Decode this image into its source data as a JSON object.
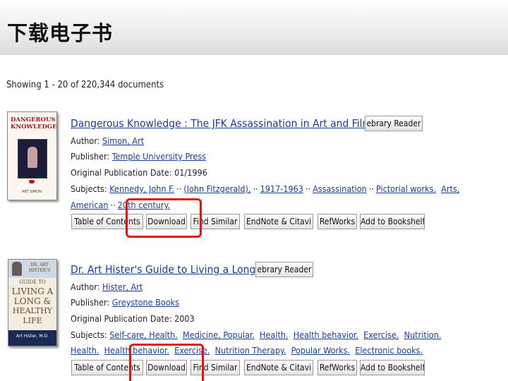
{
  "slide": {
    "title": "下载电子书"
  },
  "results": {
    "showing": "Showing 1 - 20 of 220,344 documents",
    "items": [
      {
        "title": "Dangerous Knowledge : The JFK Assassination in Art and Film",
        "reader_btn": "ebrary Reader",
        "author_label": "Author:",
        "author": "Simon, Art",
        "publisher_label": "Publisher:",
        "publisher": "Temple University Press",
        "pubdate_label": "Original Publication Date:",
        "pubdate": "01/1996",
        "subjects_label": "Subjects:",
        "subjects_line1": [
          "Kennedy, John F.",
          "(John Fitzgerald),",
          "1917-1963",
          "Assassination",
          "Pictorial works.",
          "Arts,"
        ],
        "subjects_line2": [
          "American",
          "20th century."
        ],
        "cover": {
          "title": "DANGEROUS KNOWLEDGE",
          "author": "ART SIMON"
        }
      },
      {
        "title": "Dr. Art Hister's Guide to Living a Long",
        "reader_btn": "ebrary Reader",
        "author_label": "Author:",
        "author": "Hister, Art",
        "publisher_label": "Publisher:",
        "publisher": "Greystone Books",
        "pubdate_label": "Original Publication Date:",
        "pubdate": "2003",
        "subjects_label": "Subjects:",
        "subjects_line1": [
          "Self-care, Health.",
          "Medicine, Popular.",
          "Health.",
          "Health behavior.",
          "Exercise.",
          "Nutrition."
        ],
        "subjects_line2": [
          "Health.",
          "Health behavior.",
          "Exercise.",
          "Nutrition Therapy.",
          "Popular Works.",
          "Electronic books."
        ],
        "cover": {
          "line1": "DR. ART",
          "line2": "HISTER'S",
          "line3": "GUIDE TO",
          "line4": "LIVING A",
          "line5": "LONG &",
          "line6": "HEALTHY",
          "line7": "LIFE",
          "author": "Art Hister, M.D."
        }
      }
    ],
    "actions": [
      "Table of Contents",
      "Download",
      "Find Similar",
      "EndNote & Citavi",
      "RefWorks",
      "Add to Bookshelf"
    ]
  },
  "colors": {
    "link": "#1b3d9a",
    "highlight": "#e11414"
  }
}
